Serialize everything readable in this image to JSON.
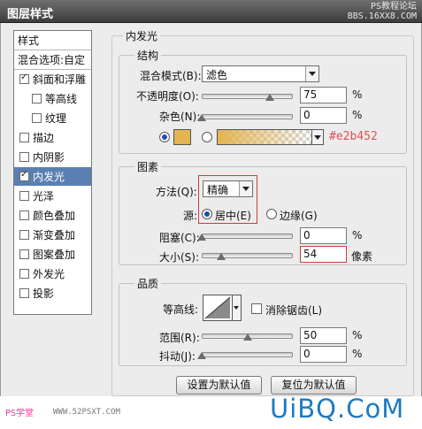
{
  "window": {
    "title": "图层样式",
    "watermark_top": [
      "PS教程论坛",
      "BBS.16XX8.COM"
    ]
  },
  "sidebar": {
    "header": "样式",
    "blend_options": "混合选项:自定",
    "items": [
      {
        "label": "斜面和浮雕",
        "checked": true,
        "indent": false
      },
      {
        "label": "等高线",
        "checked": false,
        "indent": true
      },
      {
        "label": "纹理",
        "checked": false,
        "indent": true
      },
      {
        "label": "描边",
        "checked": false,
        "indent": false
      },
      {
        "label": "内阴影",
        "checked": false,
        "indent": false
      },
      {
        "label": "内发光",
        "checked": true,
        "indent": false,
        "selected": true
      },
      {
        "label": "光泽",
        "checked": false,
        "indent": false
      },
      {
        "label": "颜色叠加",
        "checked": false,
        "indent": false
      },
      {
        "label": "渐变叠加",
        "checked": false,
        "indent": false
      },
      {
        "label": "图案叠加",
        "checked": false,
        "indent": false
      },
      {
        "label": "外发光",
        "checked": false,
        "indent": false
      },
      {
        "label": "投影",
        "checked": false,
        "indent": false
      }
    ]
  },
  "panel": {
    "title": "内发光",
    "structure": {
      "title": "结构",
      "blend_mode_label": "混合模式(B):",
      "blend_mode_value": "滤色",
      "opacity_label": "不透明度(O):",
      "opacity_value": "75",
      "opacity_fraction": 0.75,
      "noise_label": "杂色(N):",
      "noise_value": "0",
      "noise_fraction": 0,
      "unit": "%",
      "color_hex": "#e2b452",
      "color_annotation": "#e2b452"
    },
    "elements": {
      "title": "图素",
      "method_label": "方法(Q):",
      "method_value": "精确",
      "source_label": "源:",
      "source_center": "居中(E)",
      "source_edge": "边缘(G)",
      "source_selected": "center",
      "choke_label": "阻塞(C):",
      "choke_value": "0",
      "choke_fraction": 0,
      "size_label": "大小(S):",
      "size_value": "54",
      "size_fraction": 0.216,
      "percent_unit": "%",
      "px_unit": "像素"
    },
    "quality": {
      "title": "品质",
      "contour_label": "等高线:",
      "antialias_label": "消除锯齿(L)",
      "antialias_checked": false,
      "range_label": "范围(R):",
      "range_value": "50",
      "range_fraction": 0.5,
      "jitter_label": "抖动(J):",
      "jitter_value": "0",
      "jitter_fraction": 0,
      "unit": "%"
    },
    "buttons": {
      "set_default": "设置为默认值",
      "reset_default": "复位为默认值"
    }
  },
  "watermarks": {
    "bottom_left": "PS学堂",
    "bottom_left_url": "WWW.52PSXT.COM",
    "brand": "UiBQ.CoM"
  }
}
